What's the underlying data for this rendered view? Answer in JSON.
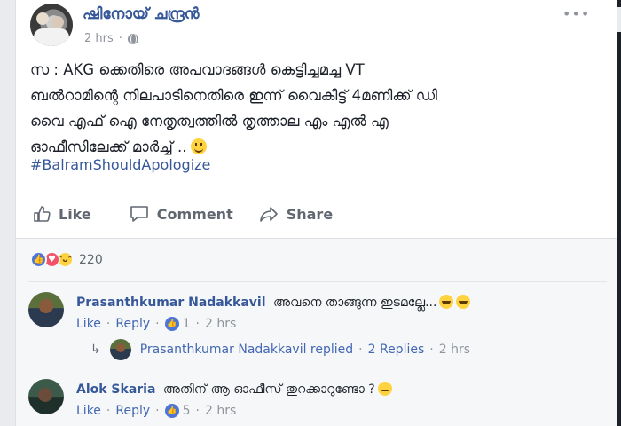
{
  "post": {
    "author": "ഷിനോയ് ചന്ദ്രൻ",
    "time": "2 hrs",
    "more": "•••",
    "text_lines": [
      "സ : AKG ക്കെതിരെ അപവാദങ്ങൾ കെട്ടിച്ചമച്ച VT",
      "ബൽറാമിന്റെ നിലപാടിനെതിരെ ഇന്ന് വൈകീട്ട് 4മണിക്ക് ഡി",
      "വൈ എഫ് ഐ നേതൃത്വത്തിൽ തൃത്താല എം എൽ എ",
      "ഓഫീസിലേക്ക് മാർച്ച് .."
    ],
    "hashtag": "#BalramShouldApologize",
    "actions": {
      "like": "Like",
      "comment": "Comment",
      "share": "Share"
    },
    "reactions_count": "220"
  },
  "comments": [
    {
      "name": "Prasanthkumar Nadakkavil",
      "text": "അവനെ താങ്ങുന്ന ഇടമല്ലേ...",
      "like": "Like",
      "reply": "Reply",
      "likes": "1",
      "time": "2 hrs"
    },
    {
      "name": "Alok Skaria",
      "text": "അതിന് ആ ഓഫീസ് തുറക്കാറുണ്ടോ ?",
      "like": "Like",
      "reply": "Reply",
      "likes": "5",
      "time": "2 hrs"
    }
  ],
  "reply_summary": {
    "text": "Prasanthkumar Nadakkavil replied",
    "dot": "·",
    "count": "2 Replies",
    "time": "2 hrs"
  },
  "colors": {
    "link": "#365899",
    "reaction_like": "#4c75d8",
    "reaction_love": "#f25268",
    "reaction_haha": "#ffd23f"
  }
}
